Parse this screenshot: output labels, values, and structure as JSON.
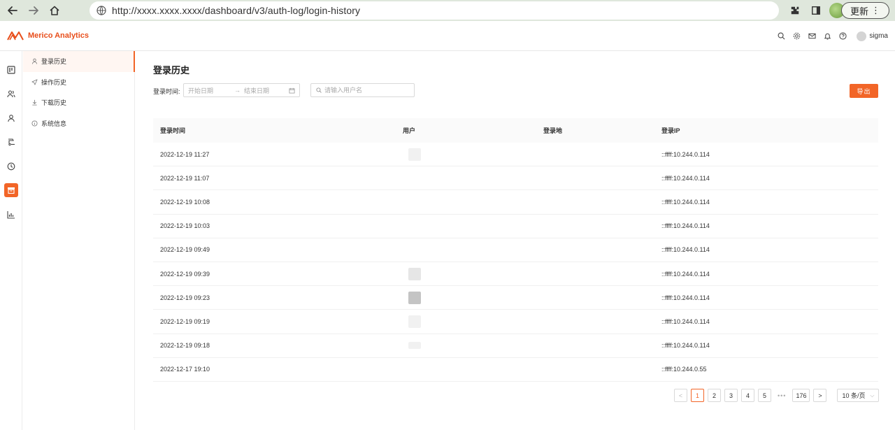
{
  "browser": {
    "url": "http://xxxx.xxxx.xxxx/dashboard/v3/auth-log/login-history",
    "update_label": "更新"
  },
  "app": {
    "logo_text": "Merico Analytics",
    "username": "sigma"
  },
  "sub_menu": {
    "items": [
      {
        "label": "登录历史",
        "icon": "user-icon",
        "active": true
      },
      {
        "label": "操作历史",
        "icon": "send-icon",
        "active": false
      },
      {
        "label": "下载历史",
        "icon": "download-icon",
        "active": false
      },
      {
        "label": "系统信息",
        "icon": "info-icon",
        "active": false
      }
    ]
  },
  "page": {
    "title": "登录历史",
    "filter_label": "登录时间:",
    "start_placeholder": "开始日期",
    "end_placeholder": "结束日期",
    "search_placeholder": "请输入用户名",
    "export_label": "导出"
  },
  "table": {
    "headers": [
      "登录时间",
      "用户",
      "登录地",
      "登录IP"
    ],
    "rows": [
      {
        "time": "2022-12-19 11:27",
        "user": "",
        "location": "",
        "ip": "::ffff:10.244.0.114"
      },
      {
        "time": "2022-12-19 11:07",
        "user": "",
        "location": "",
        "ip": "::ffff:10.244.0.114"
      },
      {
        "time": "2022-12-19 10:08",
        "user": "",
        "location": "",
        "ip": "::ffff:10.244.0.114"
      },
      {
        "time": "2022-12-19 10:03",
        "user": "",
        "location": "",
        "ip": "::ffff:10.244.0.114"
      },
      {
        "time": "2022-12-19 09:49",
        "user": "",
        "location": "",
        "ip": "::ffff:10.244.0.114"
      },
      {
        "time": "2022-12-19 09:39",
        "user": "",
        "location": "",
        "ip": "::ffff:10.244.0.114"
      },
      {
        "time": "2022-12-19 09:23",
        "user": "",
        "location": "",
        "ip": "::ffff:10.244.0.114"
      },
      {
        "time": "2022-12-19 09:19",
        "user": "",
        "location": "",
        "ip": "::ffff:10.244.0.114"
      },
      {
        "time": "2022-12-19 09:18",
        "user": "",
        "location": "",
        "ip": "::ffff:10.244.0.114"
      },
      {
        "time": "2022-12-17 19:10",
        "user": "",
        "location": "",
        "ip": "::ffff:10.244.0.55"
      }
    ]
  },
  "pagination": {
    "prev": "<",
    "pages": [
      "1",
      "2",
      "3",
      "4",
      "5"
    ],
    "dots": "•••",
    "last": "176",
    "next": ">",
    "current": "1",
    "page_size": "10 条/页"
  },
  "colors": {
    "accent": "#f26527",
    "brand": "#e84e1b"
  }
}
